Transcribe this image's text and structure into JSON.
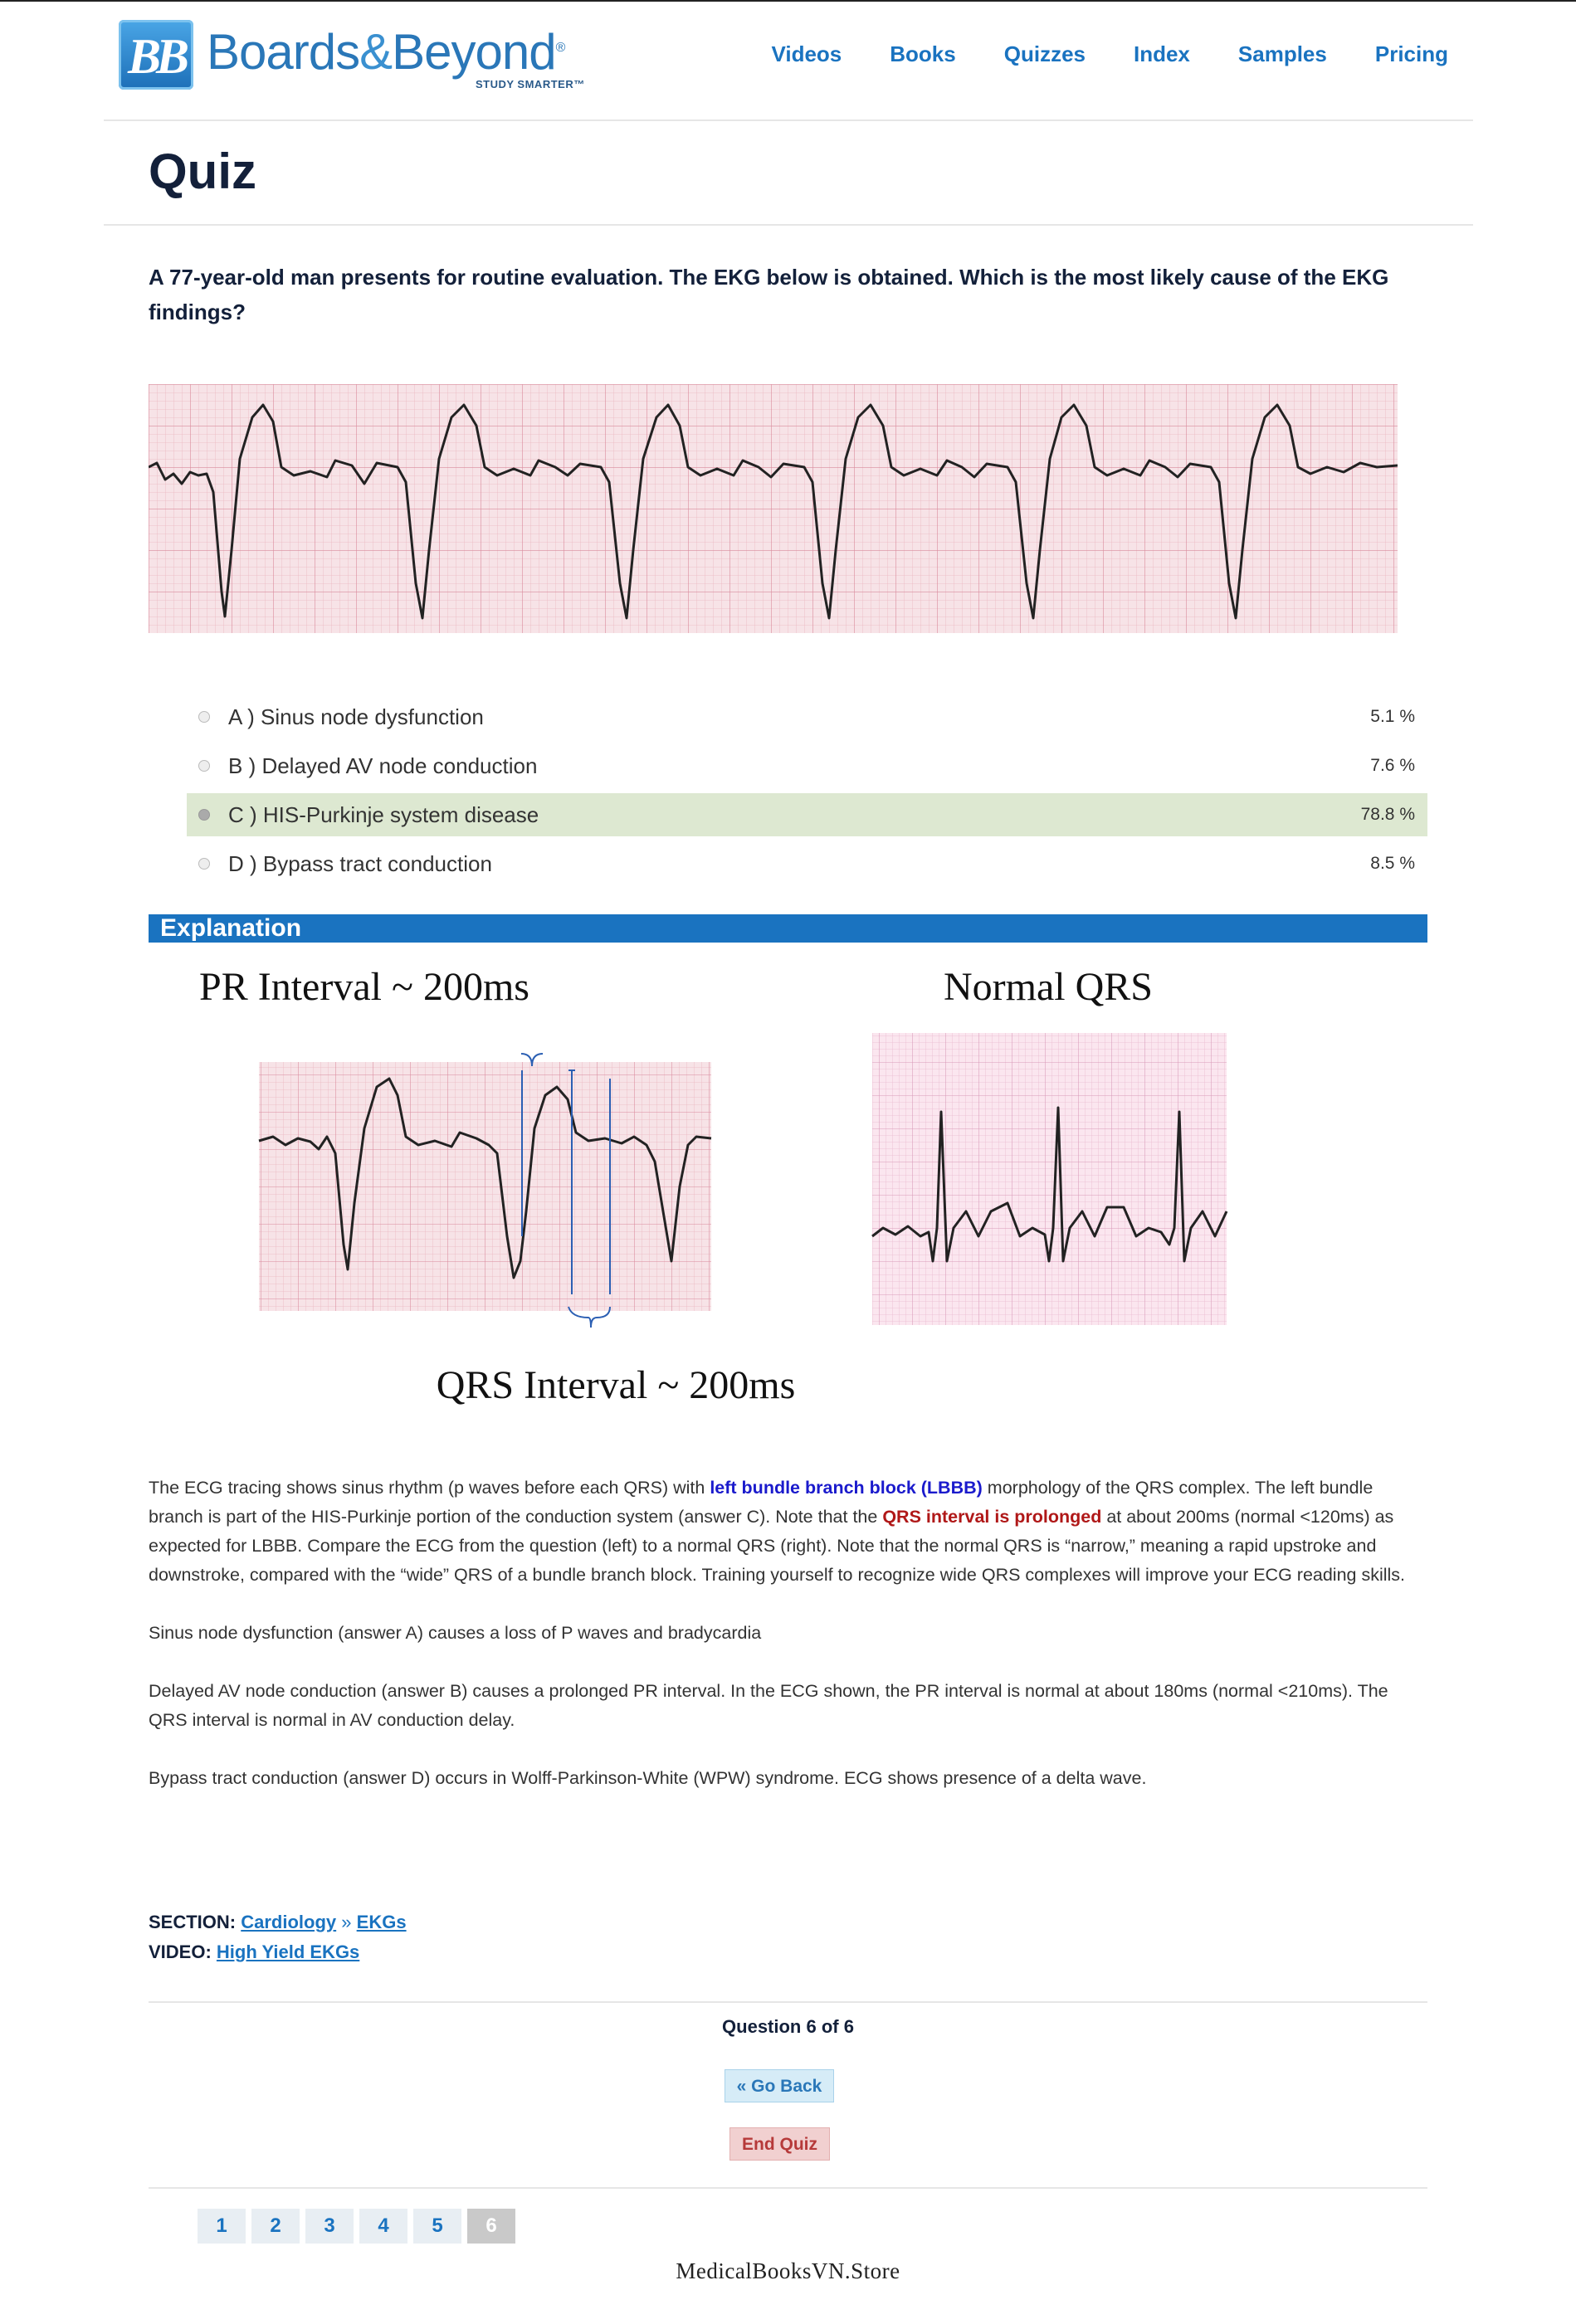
{
  "brand": {
    "name_part1": "Boards",
    "amp": "&",
    "name_part2": "Beyond",
    "mark": "®",
    "badge": "BB",
    "tagline": "STUDY SMARTER™",
    "color": "#2a77b8"
  },
  "nav": [
    "Videos",
    "Books",
    "Quizzes",
    "Index",
    "Samples",
    "Pricing"
  ],
  "page_title": "Quiz",
  "question": "A 77-year-old man presents for routine evaluation. The EKG below is obtained. Which is the most likely cause of the EKG findings?",
  "answers": [
    {
      "label": "A ) Sinus node dysfunction",
      "pct": "5.1 %",
      "selected": false
    },
    {
      "label": "B ) Delayed AV node conduction",
      "pct": "7.6 %",
      "selected": false
    },
    {
      "label": "C ) HIS-Purkinje system disease",
      "pct": "78.8 %",
      "selected": true
    },
    {
      "label": "D ) Bypass tract conduction",
      "pct": "8.5 %",
      "selected": false
    }
  ],
  "explanation_heading": "Explanation",
  "figure": {
    "pr_label": "PR Interval ~ 200ms",
    "qrs_label": "QRS Interval ~ 200ms",
    "normal_label": "Normal QRS"
  },
  "explanation": {
    "p1_a": "The ECG tracing shows sinus rhythm (p waves before each QRS) with ",
    "p1_b": "left bundle branch block (LBBB)",
    "p1_c": " morphology of the QRS complex. The left bundle branch is part of the HIS-Purkinje portion of the conduction system (answer C). Note that the ",
    "p1_d": "QRS interval is prolonged",
    "p1_e": " at about 200ms (normal <120ms) as expected for LBBB. Compare the ECG from the question (left) to a normal QRS (right). Note that the normal QRS is “narrow,” meaning a rapid upstroke and downstroke, compared with the “wide” QRS of a bundle branch block.  Training yourself to recognize wide QRS complexes will improve your ECG reading skills.",
    "p2": "Sinus node dysfunction (answer A) causes a loss of P waves and bradycardia",
    "p3": "Delayed AV node conduction (answer B) causes a prolonged PR interval. In the ECG shown, the PR interval is normal at about 180ms (normal <210ms). The QRS interval is normal in AV conduction delay.",
    "p4": "Bypass tract conduction (answer D) occurs in Wolff-Parkinson-White (WPW) syndrome.  ECG shows presence of a delta wave."
  },
  "meta": {
    "section_label": "SECTION:",
    "section_link1": "Cardiology",
    "section_sep": "»",
    "section_link2": "EKGs",
    "video_label": "VIDEO:",
    "video_link": "High Yield EKGs"
  },
  "question_count": "Question 6 of 6",
  "go_back": "« Go Back",
  "end_quiz": "End Quiz",
  "pages": [
    "1",
    "2",
    "3",
    "4",
    "5",
    "6"
  ],
  "current_page": "6",
  "footer_watermark": "MedicalBooksVN.Store",
  "colors": {
    "accent": "#1a73c0",
    "selected_answer": "#dde8d1",
    "grid_pink": "#f4d6dc",
    "grid_line": "#e7a9b6"
  }
}
